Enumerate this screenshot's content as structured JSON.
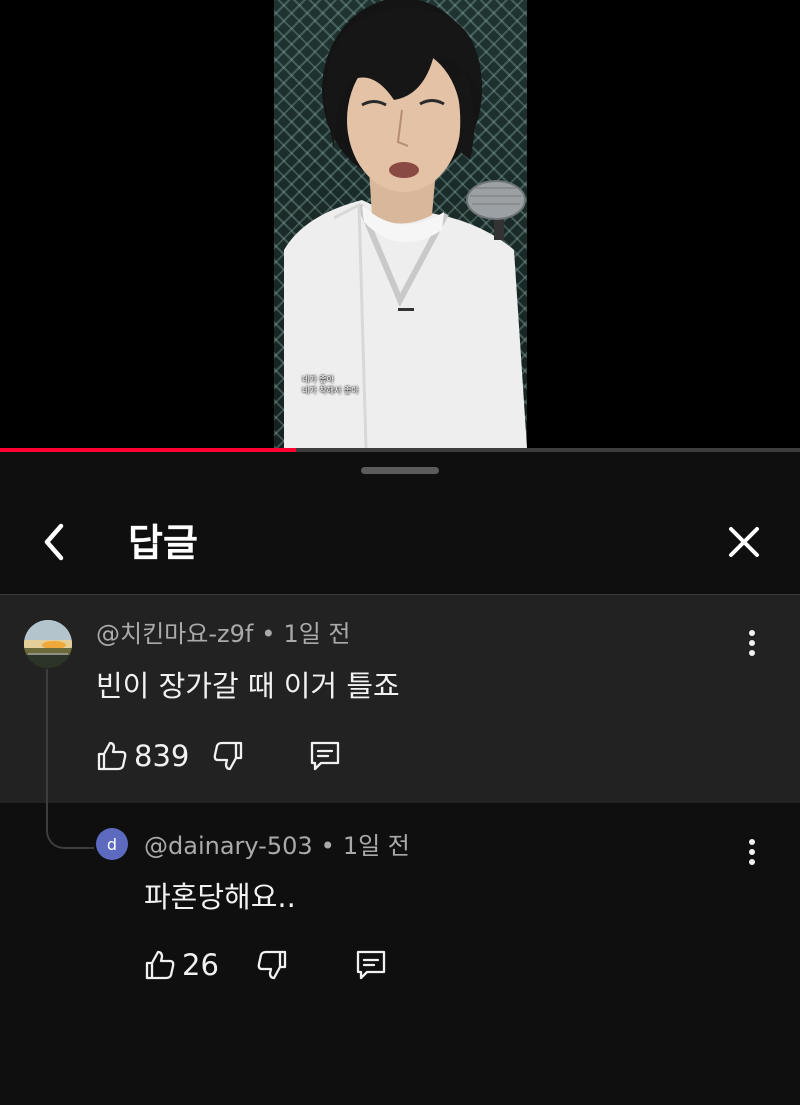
{
  "video": {
    "subtitle_line1": "네가 좋아",
    "subtitle_line2": "네가 착해서 좋아",
    "progress": 0.37
  },
  "header": {
    "title": "답글",
    "back_icon": "chevron-left-icon",
    "close_icon": "close-icon"
  },
  "comments": [
    {
      "author": "@치킨마요-z9f",
      "separator": "•",
      "time": "1일 전",
      "text": "빈이 장가갈 때 이거 틀죠",
      "likes": "839"
    },
    {
      "author": "@dainary-503",
      "avatar_letter": "d",
      "separator": "•",
      "time": "1일 전",
      "text": "파혼당해요..",
      "likes": "26"
    }
  ],
  "colors": {
    "background": "#0f0f0f",
    "highlight_row": "#222222",
    "progress": "#ff0033",
    "avatar_d": "#5c6bc0",
    "secondary_text": "#aaaaaa"
  }
}
